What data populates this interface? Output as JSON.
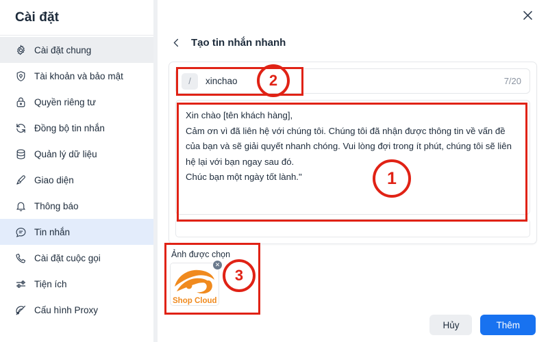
{
  "sidebar": {
    "title": "Cài đặt",
    "items": [
      {
        "label": "Cài đặt chung",
        "icon": "gear-icon",
        "state": "hovered"
      },
      {
        "label": "Tài khoản và bảo mật",
        "icon": "shield-icon",
        "state": "normal"
      },
      {
        "label": "Quyền riêng tư",
        "icon": "lock-icon",
        "state": "normal"
      },
      {
        "label": "Đồng bộ tin nhắn",
        "icon": "sync-icon",
        "state": "normal"
      },
      {
        "label": "Quản lý dữ liệu",
        "icon": "database-icon",
        "state": "normal"
      },
      {
        "label": "Giao diện",
        "icon": "brush-icon",
        "state": "normal"
      },
      {
        "label": "Thông báo",
        "icon": "bell-icon",
        "state": "normal"
      },
      {
        "label": "Tin nhắn",
        "icon": "chat-icon",
        "state": "active"
      },
      {
        "label": "Cài đặt cuộc gọi",
        "icon": "phone-icon",
        "state": "normal"
      },
      {
        "label": "Tiện ích",
        "icon": "sliders-icon",
        "state": "normal"
      },
      {
        "label": "Cấu hình Proxy",
        "icon": "proxy-icon",
        "state": "normal"
      }
    ]
  },
  "main": {
    "close_icon": "close-icon",
    "back_icon": "chevron-left-icon",
    "page_title": "Tạo tin nhắn nhanh",
    "shortcut": {
      "prefix": "/",
      "value": "xinchao",
      "placeholder": "xinchao",
      "counter": "7/20"
    },
    "message": {
      "value": "Xin chào [tên khách hàng],\nCảm ơn vì đã liên hệ với chúng tôi. Chúng tôi đã nhận được thông tin về vấn đề của bạn và sẽ giải quyết nhanh chóng. Vui lòng đợi trong ít phút, chúng tôi sẽ liên hệ lại với bạn ngay sau đó.\nChúc bạn một ngày tốt lành.\""
    },
    "attachment": {
      "label": "Ảnh được chọn",
      "thumb_name": "Shop Cloud",
      "remove_icon": "close-circle-icon"
    },
    "footer": {
      "cancel_label": "Hủy",
      "submit_label": "Thêm"
    }
  },
  "annotations": [
    {
      "number": "1",
      "target": "message-textarea"
    },
    {
      "number": "2",
      "target": "shortcut-input"
    },
    {
      "number": "3",
      "target": "attachment-section"
    }
  ],
  "colors": {
    "accent_blue": "#1872f0",
    "annotation_red": "#e02215",
    "active_nav_bg": "#e3ecfb",
    "page_bg": "#eef0f3"
  }
}
